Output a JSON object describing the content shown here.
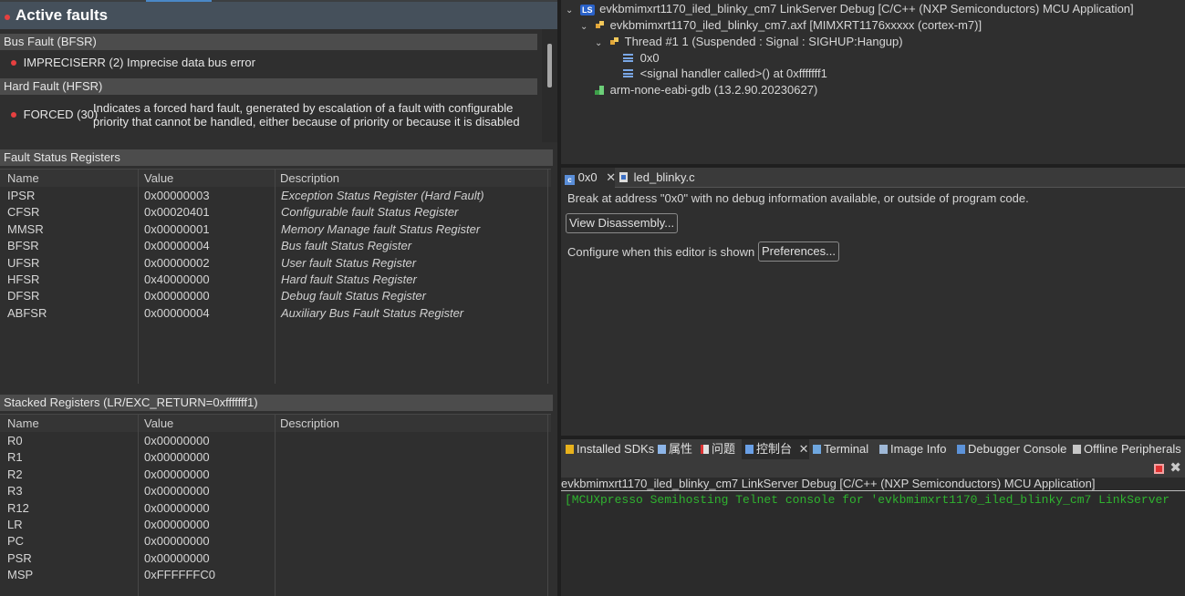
{
  "active_faults": {
    "title": "Active faults",
    "sections": [
      {
        "header": "Bus Fault (BFSR)",
        "items": [
          {
            "code": "IMPRECISERR (2)",
            "text": "Imprecise data bus error"
          }
        ]
      },
      {
        "header": "Hard Fault (HFSR)",
        "items": [
          {
            "code": "FORCED (30)",
            "text_line1": "Indicates a forced hard fault, generated by escalation of a fault with configurable",
            "text_line2": "priority that cannot be handled, either because of priority or because it is disabled"
          }
        ]
      }
    ]
  },
  "fault_status_registers": {
    "title": "Fault Status Registers",
    "columns": [
      "Name",
      "Value",
      "Description"
    ],
    "rows": [
      {
        "name": "IPSR",
        "value": "0x00000003",
        "desc": "Exception Status Register (Hard Fault)"
      },
      {
        "name": "CFSR",
        "value": "0x00020401",
        "desc": "Configurable fault Status Register"
      },
      {
        "name": "MMSR",
        "value": "0x00000001",
        "desc": "Memory Manage fault Status Register"
      },
      {
        "name": "BFSR",
        "value": "0x00000004",
        "desc": "Bus fault Status Register"
      },
      {
        "name": "UFSR",
        "value": "0x00000002",
        "desc": "User fault Status Register"
      },
      {
        "name": "HFSR",
        "value": "0x40000000",
        "desc": "Hard fault Status Register"
      },
      {
        "name": "DFSR",
        "value": "0x00000000",
        "desc": "Debug fault Status Register"
      },
      {
        "name": "ABFSR",
        "value": "0x00000004",
        "desc": "Auxiliary Bus Fault Status Register"
      }
    ]
  },
  "stacked_registers": {
    "title": "Stacked Registers (LR/EXC_RETURN=0xfffffff1)",
    "columns": [
      "Name",
      "Value",
      "Description"
    ],
    "rows": [
      {
        "name": "R0",
        "value": "0x00000000"
      },
      {
        "name": "R1",
        "value": "0x00000000"
      },
      {
        "name": "R2",
        "value": "0x00000000"
      },
      {
        "name": "R3",
        "value": "0x00000000"
      },
      {
        "name": "R12",
        "value": "0x00000000"
      },
      {
        "name": "LR",
        "value": "0x00000000"
      },
      {
        "name": "PC",
        "value": "0x00000000"
      },
      {
        "name": "PSR",
        "value": "0x00000000"
      },
      {
        "name": "MSP",
        "value": "0xFFFFFFC0"
      }
    ]
  },
  "debug_tree": {
    "launch": "evkbmimxrt1170_iled_blinky_cm7 LinkServer Debug [C/C++ (NXP Semiconductors) MCU Application]",
    "launch_badge": "LS",
    "process": "evkbmimxrt1170_iled_blinky_cm7.axf [MIMXRT1176xxxxx (cortex-m7)]",
    "thread": "Thread #1 1 (Suspended : Signal : SIGHUP:Hangup)",
    "frames": [
      "0x0",
      "<signal handler called>() at 0xfffffff1"
    ],
    "gdb": "arm-none-eabi-gdb (13.2.90.20230627)"
  },
  "editor": {
    "tabs": [
      {
        "label": "0x0",
        "icon": "c-file-icon"
      },
      {
        "label": "led_blinky.c",
        "icon": "file-icon"
      }
    ],
    "message": "Break at address \"0x0\" with no debug information available, or outside of program code.",
    "view_disassembly_button": "View Disassembly...",
    "configure_label": "Configure when this editor is shown",
    "preferences_button": "Preferences..."
  },
  "console": {
    "tabs": [
      "Installed SDKs",
      "属性",
      "问题",
      "控制台",
      "Terminal",
      "Image Info",
      "Debugger Console",
      "Offline Peripherals"
    ],
    "active_tab": "控制台",
    "title": "evkbmimxrt1170_iled_blinky_cm7 LinkServer Debug [C/C++ (NXP Semiconductors) MCU Application]",
    "output": "[MCUXpresso Semihosting Telnet console for 'evkbmimxrt1170_iled_blinky_cm7 LinkServer"
  },
  "colors": {
    "accent": "#4a88c7",
    "fault_bullet": "#e64040",
    "console_text": "#2fb32f",
    "stop": "#e03131"
  }
}
